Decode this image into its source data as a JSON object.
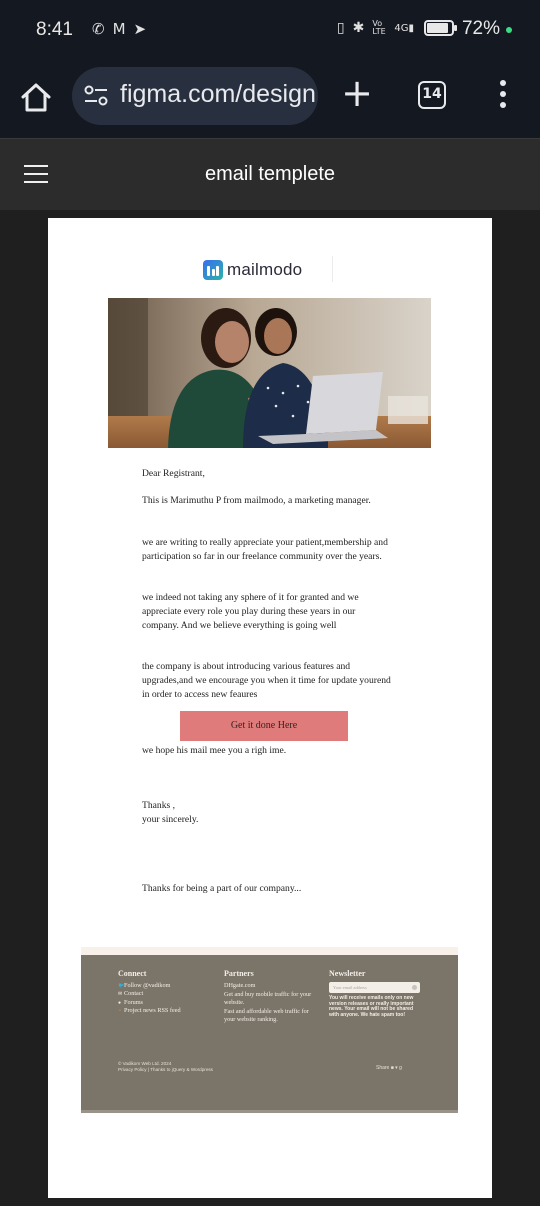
{
  "status_bar": {
    "time": "8:41",
    "left_icons": [
      "phone-icon",
      "gmail-icon",
      "telegram-icon"
    ],
    "right_icons": [
      "vibrate-icon",
      "bluetooth-icon",
      "volte-icon",
      "signal-4g-icon",
      "battery-icon"
    ],
    "volte_label": "Vo LTE",
    "network_label": "4G",
    "battery_percent": "72%"
  },
  "browser": {
    "url": "figma.com/design",
    "tab_count": "14"
  },
  "figma_header": {
    "title": "email templete"
  },
  "email": {
    "logo_text": "mailmodo",
    "greeting": "Dear Registrant,",
    "paragraphs": [
      "This is Marimuthu P from mailmodo, a marketing manager.",
      "we are writing to really appreciate your patient,membership and participation so far in our freelance community over the years.",
      "we indeed not taking any sphere of it for granted and we appreciate every role you play during these years in our company. And we believe everything is going well",
      "the company is about  introducing various features and upgrades,and we encourage you when it time for update yourend in order to access new feaures"
    ],
    "cta_label": "Get it done Here",
    "after_cta": "we hope his mail mee you a righ ime.",
    "signoff_1": "Thanks ,",
    "signoff_2": "your sincerely.",
    "closing": "Thanks for being a part of our company..."
  },
  "footer": {
    "connect": {
      "heading": "Connect",
      "items": [
        {
          "icon": "twitter-icon",
          "label": "Follow @vadikom"
        },
        {
          "icon": "mail-icon",
          "label": "Contact"
        },
        {
          "icon": "chat-icon",
          "label": "Forums"
        },
        {
          "icon": "rss-icon",
          "label": "Project news RSS feed"
        }
      ]
    },
    "partners": {
      "heading": "Partners",
      "items": [
        "DHgate.com",
        "Get and buy mobile traffic for your website.",
        "Fast and affordable web traffic for your website ranking."
      ]
    },
    "newsletter": {
      "heading": "Newsletter",
      "placeholder": "Your email address",
      "text": "You will receive emails only on new version releases or really important news. Your email will not be shared with anyone. We hate spam too!"
    },
    "copyright": "© Vadikom Web Ltd. 2024",
    "links": "Privacy Policy | Thanks to jQuery & Wordpress",
    "share_label": "Share"
  },
  "colors": {
    "cta_bg": "#e07b7b",
    "footer_bg": "#7b7468",
    "figma_header_bg": "#2c2c2c",
    "browser_bg": "#141820"
  }
}
